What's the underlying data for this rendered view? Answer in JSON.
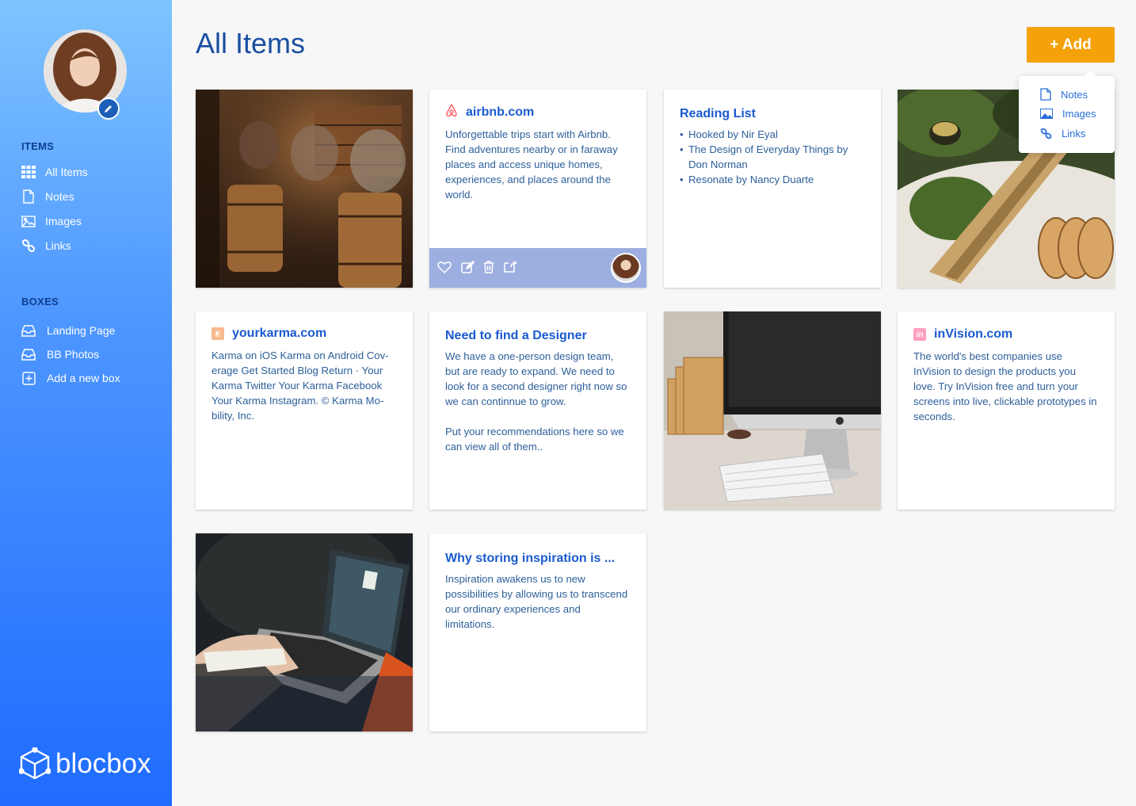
{
  "sidebar": {
    "items_heading": "ITEMS",
    "items": [
      {
        "label": "All Items",
        "icon": "grid-icon"
      },
      {
        "label": "Notes",
        "icon": "note-icon"
      },
      {
        "label": "Images",
        "icon": "image-icon"
      },
      {
        "label": "Links",
        "icon": "link-icon"
      }
    ],
    "boxes_heading": "BOXES",
    "boxes": [
      {
        "label": "Landing Page",
        "icon": "inbox-icon"
      },
      {
        "label": "BB Photos",
        "icon": "inbox-icon"
      },
      {
        "label": "Add a new box",
        "icon": "plus-square-icon"
      }
    ],
    "brand": "blocbox"
  },
  "header": {
    "title": "All Items",
    "add_label": "+ Add"
  },
  "add_menu": [
    {
      "label": "Notes",
      "icon": "note-icon"
    },
    {
      "label": "Images",
      "icon": "image-icon"
    },
    {
      "label": "Links",
      "icon": "link-icon"
    }
  ],
  "cards": {
    "airbnb": {
      "title": "airbnb.com",
      "text": "Unforgettable trips start with Airbnb. Find adventures nearby or in faraway places and access unique homes, experiences, and places around the world."
    },
    "reading": {
      "title": "Reading List",
      "items": [
        "Hooked by Nir Eyal",
        "The Design of Everyday Things by Don Norman",
        "Resonate by Nancy Duarte"
      ]
    },
    "karma": {
      "title": "yourkarma.com",
      "text": "Karma on iOS Karma on Android Cov­erage Get Started Blog Return · Your Karma Twitter Your Karma Facebook Your Karma Instagram. © Karma Mo­bility, Inc."
    },
    "designer": {
      "title": "Need to find a Designer",
      "p1": "We have a one-person design team, but are ready to expand. We need to look for a second designer right now so we can continnue to grow.",
      "p2": "Put your recommendations here so we can view all of them.."
    },
    "invision": {
      "title": "inVision.com",
      "favicon_text": "in",
      "text": "The world's best companies use InVision to design the products you love. Try InVision free and turn your screens into live, clickable prototypes in seconds."
    },
    "inspiration": {
      "title": "Why storing inspiration is ...",
      "text": "Inspiration awakens us to new possibilities by allowing us to transcend our ordinary experiences and limitations."
    }
  },
  "colors": {
    "accent": "#f4a10a",
    "link_blue": "#1a5ad0",
    "sidebar_top": "#7ec4ff",
    "sidebar_bottom": "#1f6cff"
  }
}
